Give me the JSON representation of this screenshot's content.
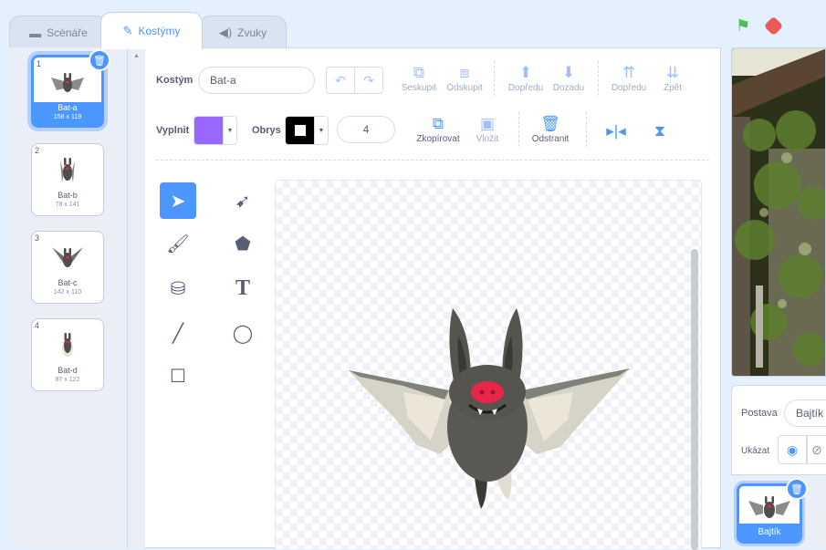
{
  "tabs": [
    {
      "label": "Scénáře",
      "icon": "code-icon"
    },
    {
      "label": "Kostýmy",
      "icon": "brush-icon"
    },
    {
      "label": "Zvuky",
      "icon": "speaker-icon"
    }
  ],
  "costumes": [
    {
      "num": "1",
      "name": "Bat-a",
      "dims": "158 x 119",
      "selected": true
    },
    {
      "num": "2",
      "name": "Bat-b",
      "dims": "78 x 141"
    },
    {
      "num": "3",
      "name": "Bat-c",
      "dims": "142 x 110"
    },
    {
      "num": "4",
      "name": "Bat-d",
      "dims": "87 x 122"
    }
  ],
  "editor": {
    "costume_label": "Kostým",
    "costume_name": "Bat-a",
    "group": "Seskupit",
    "ungroup": "Odskupit",
    "forward": "Dopředu",
    "backward": "Dozadu",
    "front": "Dopředu",
    "back": "Zpět",
    "fill_label": "Vyplnit",
    "outline_label": "Obrys",
    "outline_width": "4",
    "copy": "Zkopírovat",
    "paste": "Vložit",
    "delete": "Odstranit",
    "fill_color": "#9966ff",
    "outline_color": "#000000"
  },
  "sprite_panel": {
    "sprite_label": "Postava",
    "sprite_name": "Bajtík",
    "show_label": "Ukázat",
    "sprite_tile_name": "Bajtík"
  },
  "colors": {
    "accent": "#4c97ff",
    "flag": "#4cbf56",
    "stop": "#ec5959"
  }
}
